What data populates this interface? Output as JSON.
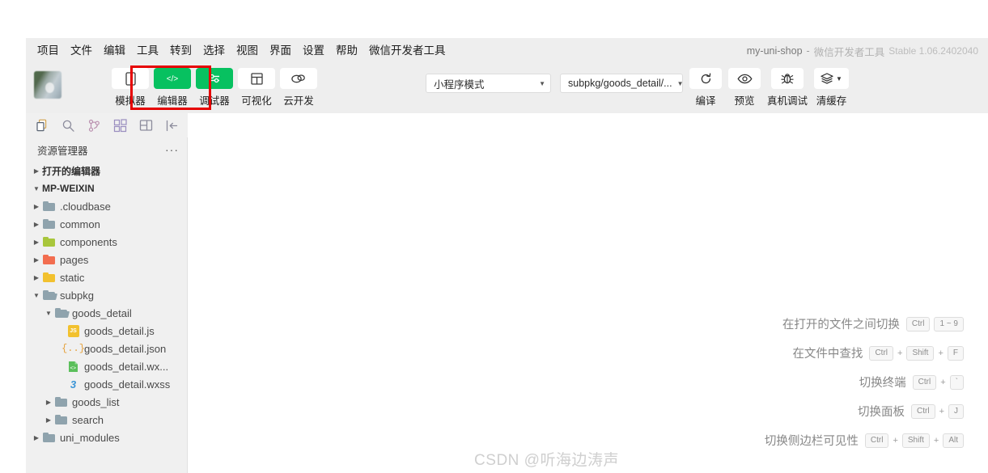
{
  "window": {
    "project_name": "my-uni-shop",
    "separator": "-",
    "app_name": "微信开发者工具",
    "version": "Stable 1.06.2402040"
  },
  "menubar": {
    "items": [
      {
        "label": "项目"
      },
      {
        "label": "文件"
      },
      {
        "label": "编辑"
      },
      {
        "label": "工具"
      },
      {
        "label": "转到"
      },
      {
        "label": "选择"
      },
      {
        "label": "视图"
      },
      {
        "label": "界面"
      },
      {
        "label": "设置"
      },
      {
        "label": "帮助"
      },
      {
        "label": "微信开发者工具"
      }
    ]
  },
  "toolbar": {
    "buttons": [
      {
        "label": "模拟器",
        "icon": "phone-icon",
        "active": false,
        "highlighted": true
      },
      {
        "label": "编辑器",
        "icon": "code-icon",
        "active": true,
        "highlighted": false
      },
      {
        "label": "调试器",
        "icon": "sliders-icon",
        "active": true,
        "highlighted": false
      },
      {
        "label": "可视化",
        "icon": "layout-icon",
        "active": false,
        "highlighted": false
      },
      {
        "label": "云开发",
        "icon": "cloud-icon",
        "active": false,
        "highlighted": false
      }
    ],
    "mode_select": {
      "value": "小程序模式"
    },
    "page_select": {
      "value": "subpkg/goods_detail/..."
    },
    "right_buttons": [
      {
        "label": "编译",
        "icon": "refresh-icon",
        "has_caret": false
      },
      {
        "label": "预览",
        "icon": "eye-icon",
        "has_caret": false
      },
      {
        "label": "真机调试",
        "icon": "bug-icon",
        "has_caret": false
      },
      {
        "label": "清缓存",
        "icon": "layers-icon",
        "has_caret": true
      }
    ],
    "highlight_color": "#e60000",
    "accent_color": "#07c160"
  },
  "activitybar": {
    "items": [
      {
        "name": "explorer-icon",
        "active": true
      },
      {
        "name": "search-icon",
        "active": false
      },
      {
        "name": "source-control-icon",
        "active": false
      },
      {
        "name": "extensions-icon",
        "active": false
      },
      {
        "name": "debug-layout-icon",
        "active": false
      },
      {
        "name": "collapse-sidebar-icon",
        "active": false
      }
    ]
  },
  "sidebar": {
    "title": "资源管理器",
    "more_label": "···",
    "sections": [
      {
        "label": "打开的编辑器",
        "expanded": false
      },
      {
        "label": "MP-WEIXIN",
        "expanded": true
      }
    ],
    "tree": [
      {
        "label": ".cloudbase",
        "type": "folder",
        "depth": 1,
        "expanded": false,
        "color": "#8fa3ad"
      },
      {
        "label": "common",
        "type": "folder",
        "depth": 1,
        "expanded": false,
        "color": "#8fa3ad"
      },
      {
        "label": "components",
        "type": "folder",
        "depth": 1,
        "expanded": false,
        "color": "#a8c63c"
      },
      {
        "label": "pages",
        "type": "folder",
        "depth": 1,
        "expanded": false,
        "color": "#f26d4f"
      },
      {
        "label": "static",
        "type": "folder",
        "depth": 1,
        "expanded": false,
        "color": "#f2c12e"
      },
      {
        "label": "subpkg",
        "type": "folder",
        "depth": 1,
        "expanded": true,
        "color": "#8fa3ad"
      },
      {
        "label": "goods_detail",
        "type": "folder",
        "depth": 2,
        "expanded": true,
        "color": "#8fa3ad"
      },
      {
        "label": "goods_detail.js",
        "type": "file",
        "depth": 3,
        "filetype": "js",
        "color": "#f2c12e"
      },
      {
        "label": "goods_detail.json",
        "type": "file",
        "depth": 3,
        "filetype": "json",
        "color": "#e5a13b"
      },
      {
        "label": "goods_detail.wx...",
        "type": "file",
        "depth": 3,
        "filetype": "wxml",
        "color": "#5bbf5b"
      },
      {
        "label": "goods_detail.wxss",
        "type": "file",
        "depth": 3,
        "filetype": "css",
        "color": "#3a94d6"
      },
      {
        "label": "goods_list",
        "type": "folder",
        "depth": 2,
        "expanded": false,
        "color": "#8fa3ad"
      },
      {
        "label": "search",
        "type": "folder",
        "depth": 2,
        "expanded": false,
        "color": "#8fa3ad"
      },
      {
        "label": "uni_modules",
        "type": "folder",
        "depth": 1,
        "expanded": false,
        "color": "#8fa3ad"
      }
    ]
  },
  "editor": {
    "shortcuts": [
      {
        "label": "在打开的文件之间切换",
        "keys": [
          "Ctrl",
          "1 ~ 9"
        ],
        "joined": false
      },
      {
        "label": "在文件中查找",
        "keys": [
          "Ctrl",
          "Shift",
          "F"
        ],
        "joined": true
      },
      {
        "label": "切换终端",
        "keys": [
          "Ctrl",
          "`"
        ],
        "joined": true
      },
      {
        "label": "切换面板",
        "keys": [
          "Ctrl",
          "J"
        ],
        "joined": true
      },
      {
        "label": "切换侧边栏可见性",
        "keys": [
          "Ctrl",
          "Shift",
          "Alt"
        ],
        "joined": true
      }
    ],
    "watermark": "CSDN @听海边涛声"
  }
}
